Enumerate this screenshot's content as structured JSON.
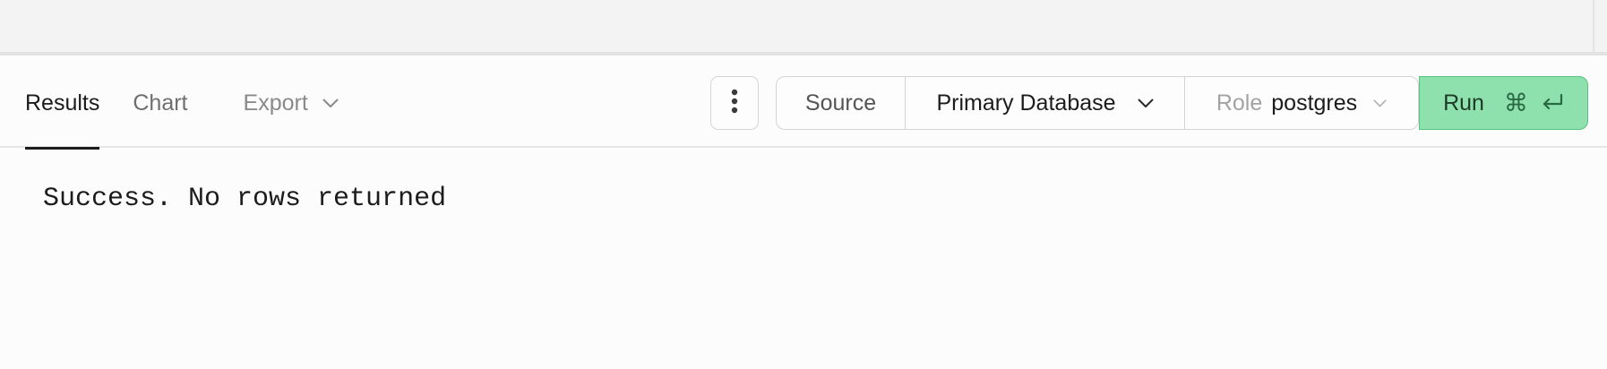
{
  "tabs": [
    {
      "label": "Results",
      "active": true
    },
    {
      "label": "Chart",
      "active": false
    },
    {
      "label": "Export",
      "active": false,
      "has_dropdown": true
    }
  ],
  "toolbar": {
    "more_icon": "vertical-ellipsis-icon",
    "source_label": "Source",
    "database_value": "Primary Database",
    "role_label": "Role",
    "role_value": "postgres",
    "run_label": "Run",
    "run_shortcut_cmd": "⌘",
    "run_shortcut_enter_icon": "enter-return-icon"
  },
  "result": {
    "message": "Success. No rows returned"
  },
  "colors": {
    "run_bg": "#8ee0ad",
    "run_border": "#55c47f",
    "active_tab_underline": "#1c1c1c"
  }
}
